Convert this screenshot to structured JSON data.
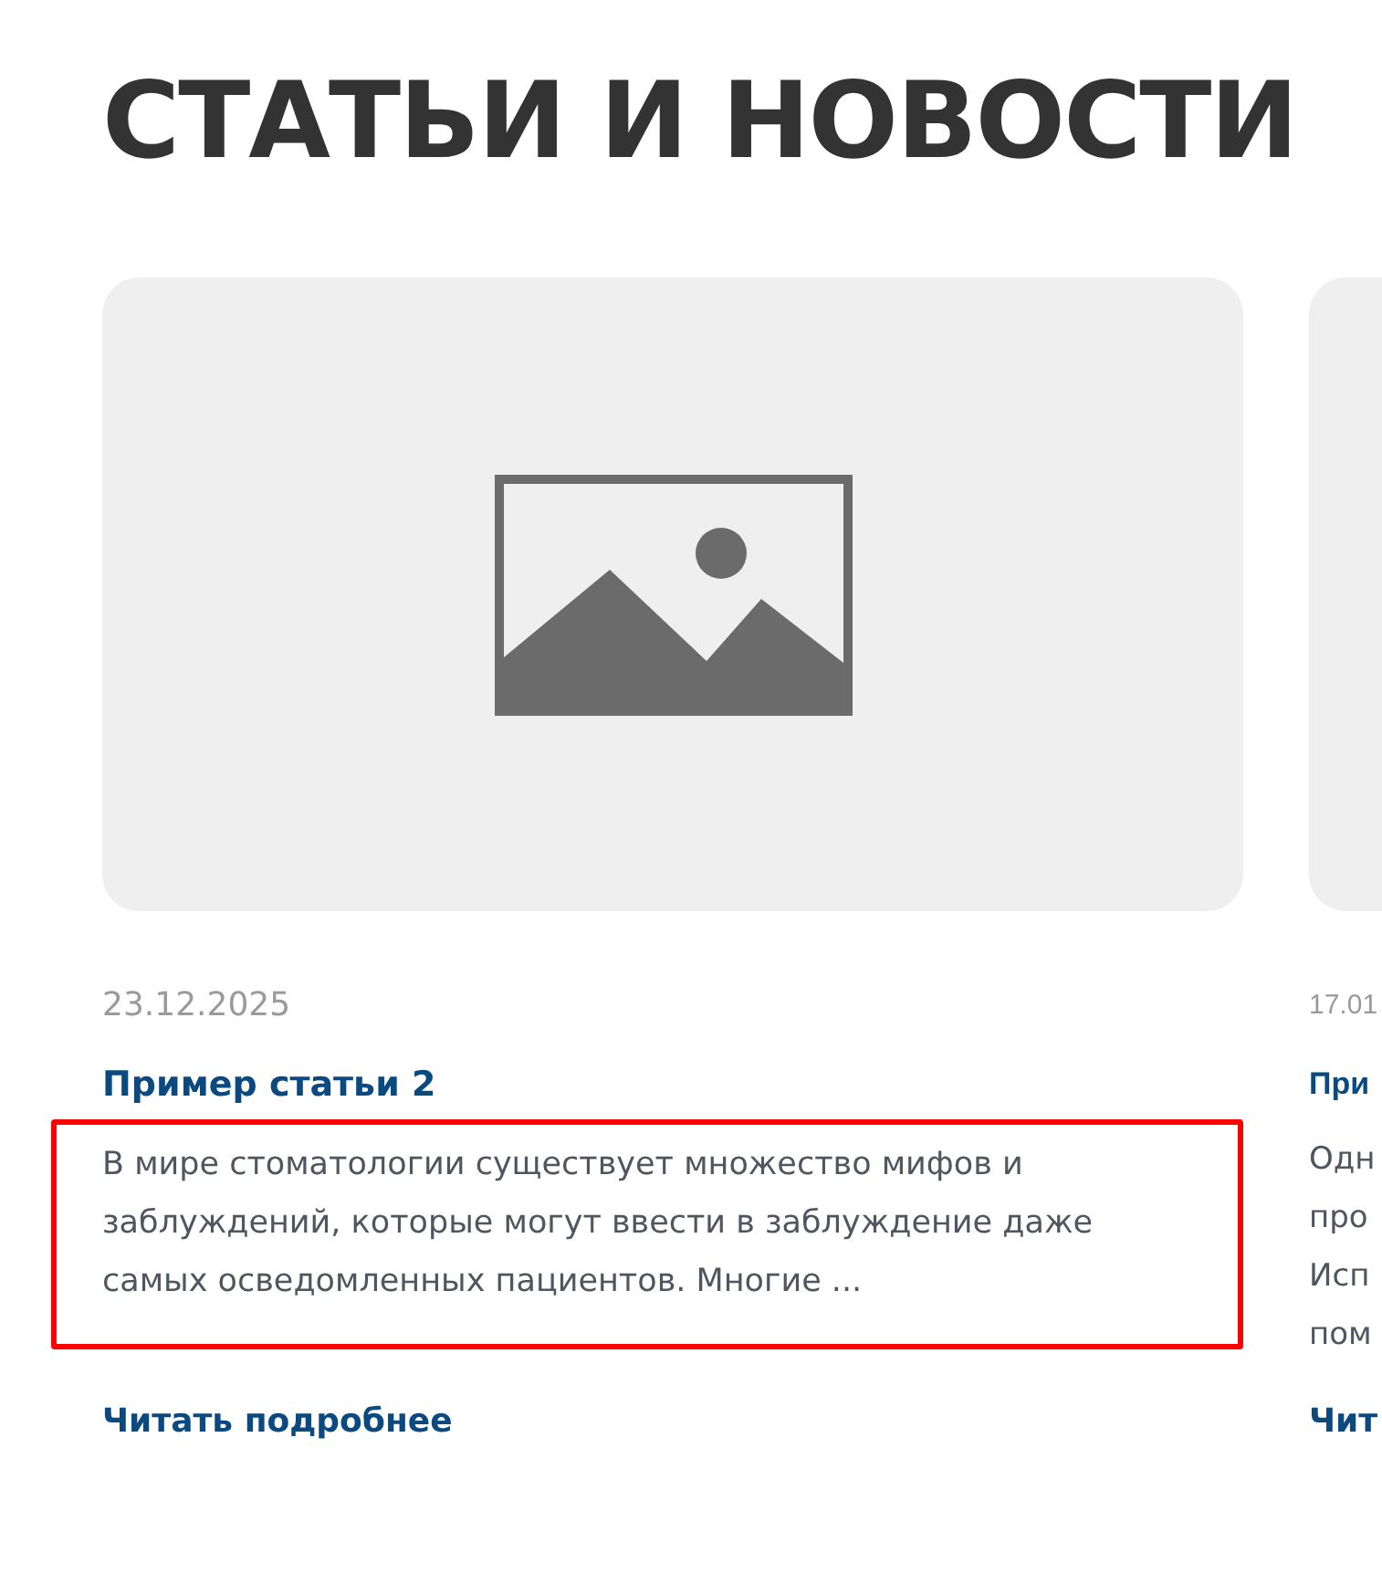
{
  "heading": "СТАТЬИ И НОВОСТИ",
  "cards": [
    {
      "kind": "full",
      "image": {
        "kind": "placeholder"
      },
      "date": "23.12.2025",
      "title": "Пример статьи 2",
      "excerpt_lines": [
        "В мире стоматологии существует множество мифов и",
        "заблуждений, которые могут ввести в заблуждение даже",
        "самых осведомленных пациентов. Многие ..."
      ],
      "highlighted": true,
      "link": "Читать подробнее"
    },
    {
      "kind": "partial",
      "image": {
        "kind": "placeholder"
      },
      "date": "17.01",
      "title": "При",
      "excerpt_lines": [
        "Одн",
        "про",
        "Исп",
        "пом"
      ],
      "link": "Чит"
    }
  ]
}
